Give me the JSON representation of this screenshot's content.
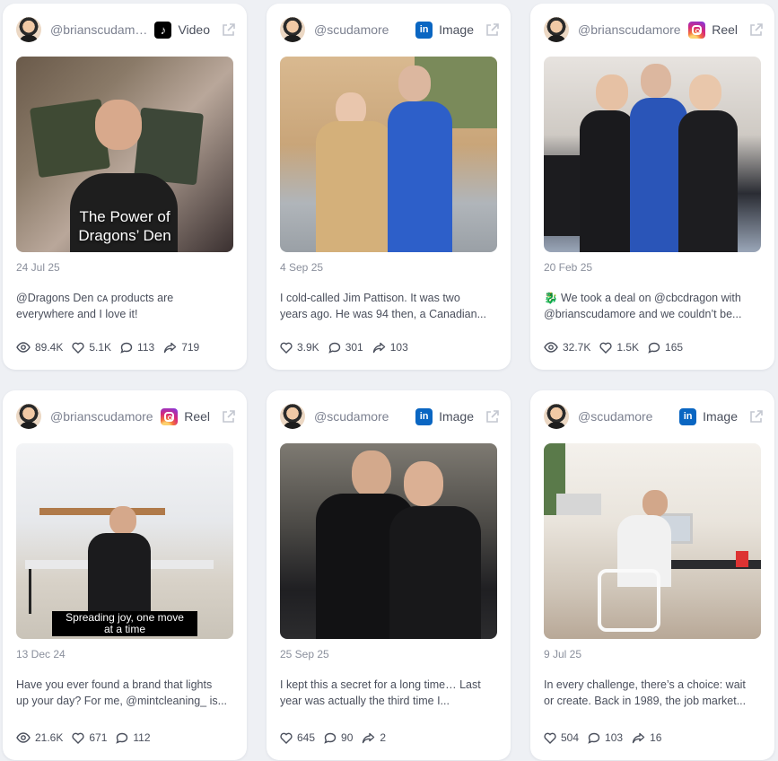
{
  "posts": [
    {
      "handle": "@brianscudamore",
      "platform": "Video",
      "platform_icon": "tiktok-icon",
      "overlay": "The Power of\nDragons’ Den",
      "date": "24 Jul 25",
      "desc_line1": "@Dragons Den ᴄᴀ products are",
      "desc_line2": "everywhere and I love it!",
      "views": "89.4K",
      "likes": "5.1K",
      "comments": "113",
      "shares": "719"
    },
    {
      "handle": "@scudamore",
      "platform": "Image",
      "platform_icon": "linkedin-icon",
      "overlay": "",
      "date": "4 Sep 25",
      "desc_line1": "I cold-called Jim Pattison. It was two",
      "desc_line2": "years ago. He was 94 then, a Canadian...",
      "likes": "3.9K",
      "comments": "301",
      "shares": "103"
    },
    {
      "handle": "@brianscudamore",
      "platform": "Reel",
      "platform_icon": "instagram-icon",
      "overlay": "",
      "date": "20 Feb 25",
      "desc_line1": "🐉 We took a deal on @cbcdragon with",
      "desc_line2": "@brianscudamore and we couldn’t be...",
      "views": "32.7K",
      "likes": "1.5K",
      "comments": "165"
    },
    {
      "handle": "@brianscudamore",
      "platform": "Reel",
      "platform_icon": "instagram-icon",
      "overlay": "Spreading joy, one move\nat a time",
      "date": "13 Dec 24",
      "desc_line1": "Have you ever found a brand that lights",
      "desc_line2": "up your day? For me, @mintcleaning_ is...",
      "views": "21.6K",
      "likes": "671",
      "comments": "112"
    },
    {
      "handle": "@scudamore",
      "platform": "Image",
      "platform_icon": "linkedin-icon",
      "overlay": "",
      "date": "25 Sep 25",
      "desc_line1": "I kept this a secret for a long time… Last",
      "desc_line2": "year was actually the third time I...",
      "likes": "645",
      "comments": "90",
      "shares": "2"
    },
    {
      "handle": "@scudamore",
      "platform": "Image",
      "platform_icon": "linkedin-icon",
      "overlay": "",
      "date": "9 Jul 25",
      "desc_line1": "In every challenge, there’s a choice: wait",
      "desc_line2": "or create. Back in 1989, the job market...",
      "likes": "504",
      "comments": "103",
      "shares": "16"
    }
  ]
}
